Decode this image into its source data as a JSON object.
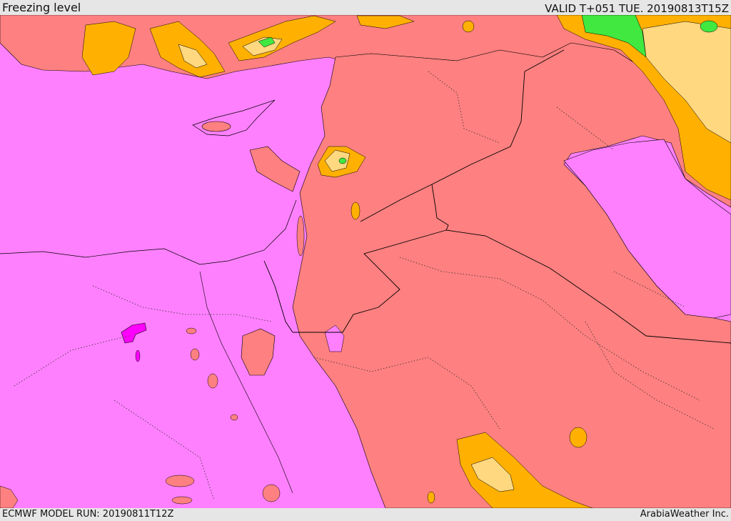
{
  "header": {
    "title": "Freezing level",
    "valid_time": "VALID T+051 TUE. 20190813T15Z"
  },
  "footer": {
    "model_run": "ECMWF MODEL RUN: 20190811T12Z",
    "credit": "ArabiaWeather Inc."
  },
  "map": {
    "palette": {
      "sea": "#ff80ff",
      "land_warm": "#ff8080",
      "orange": "#ffb000",
      "tan": "#ffd880",
      "green": "#40e840",
      "magenta": "#ff00ff",
      "outline": "#000000"
    }
  }
}
